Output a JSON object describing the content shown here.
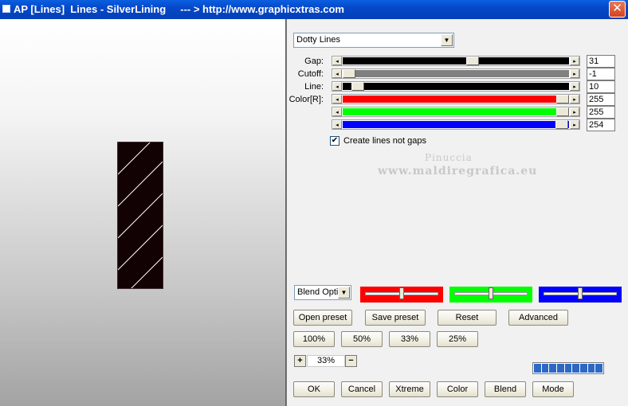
{
  "window": {
    "title": "AP [Lines]  Lines - SilverLining     --- > http://www.graphicxtras.com",
    "close_glyph": "✕"
  },
  "preset": {
    "selected": "Dotty Lines"
  },
  "sliders": [
    {
      "label": "Gap:",
      "value": "31",
      "fill_color": "#000000",
      "fraction": 0.58
    },
    {
      "label": "Cutoff:",
      "value": "-1",
      "fill_color": "#808080",
      "fraction": 0.0
    },
    {
      "label": "Line:",
      "value": "10",
      "fill_color": "#000000",
      "fraction": 0.04
    },
    {
      "label": "Color[R]:",
      "value": "255",
      "fill_color": "#ff0000",
      "fraction": 1.0
    },
    {
      "label": "",
      "value": "255",
      "fill_color": "#00ff00",
      "fraction": 1.0
    },
    {
      "label": "",
      "value": "254",
      "fill_color": "#0000ff",
      "fraction": 0.996
    }
  ],
  "create_lines": {
    "label": "Create lines not gaps",
    "checked": true
  },
  "watermark": {
    "line1": "Pinuccia",
    "line2": "www.maldiregrafica.eu"
  },
  "blend": {
    "dropdown_value": "Blend Optio",
    "swatches": [
      {
        "color": "#ff0000",
        "fraction": 0.5
      },
      {
        "color": "#00ff00",
        "fraction": 0.5
      },
      {
        "color": "#0000ff",
        "fraction": 0.5
      }
    ]
  },
  "buttons": {
    "open_preset": "Open preset",
    "save_preset": "Save preset",
    "reset": "Reset",
    "advanced": "Advanced",
    "z100": "100%",
    "z50": "50%",
    "z33": "33%",
    "z25": "25%",
    "ok": "OK",
    "cancel": "Cancel",
    "xtreme": "Xtreme",
    "color": "Color",
    "blend": "Blend",
    "mode": "Mode"
  },
  "zoom": {
    "plus": "+",
    "minus": "−",
    "value": "33%"
  },
  "progress": {
    "fraction": 1.0
  },
  "preview": {
    "background": "#130204",
    "line_color": "#ffffff"
  },
  "icons": {
    "dropdown_arrow": "▼",
    "left_arrow": "◂",
    "right_arrow": "▸",
    "check": "✔"
  }
}
